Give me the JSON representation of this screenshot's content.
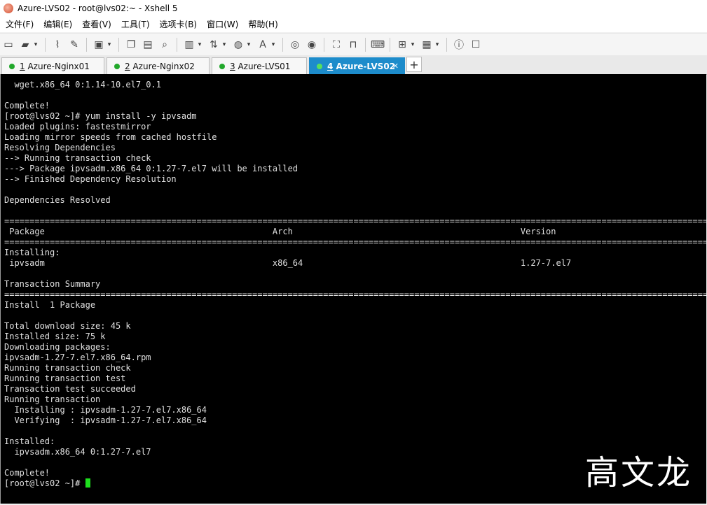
{
  "window": {
    "title": "Azure-LVS02 - root@lvs02:~ - Xshell 5"
  },
  "menu": [
    "文件(F)",
    "编辑(E)",
    "查看(V)",
    "工具(T)",
    "选项卡(B)",
    "窗口(W)",
    "帮助(H)"
  ],
  "tabs": [
    {
      "num": "1",
      "label": "Azure-Nginx01"
    },
    {
      "num": "2",
      "label": "Azure-Nginx02"
    },
    {
      "num": "3",
      "label": "Azure-LVS01"
    },
    {
      "num": "4",
      "label": "Azure-LVS02"
    }
  ],
  "terminal": {
    "text": "  wget.x86_64 0:1.14-10.el7_0.1\n\nComplete!\n[root@lvs02 ~]# yum install -y ipvsadm\nLoaded plugins: fastestmirror\nLoading mirror speeds from cached hostfile\nResolving Dependencies\n--> Running transaction check\n---> Package ipvsadm.x86_64 0:1.27-7.el7 will be installed\n--> Finished Dependency Resolution\n\nDependencies Resolved\n\n================================================================================================================================================================\n Package                                             Arch                                             Version                                             R\n================================================================================================================================================================\nInstalling:\n ipvsadm                                             x86_64                                           1.27-7.el7                                          b\n\nTransaction Summary\n================================================================================================================================================================\nInstall  1 Package\n\nTotal download size: 45 k\nInstalled size: 75 k\nDownloading packages:\nipvsadm-1.27-7.el7.x86_64.rpm\nRunning transaction check\nRunning transaction test\nTransaction test succeeded\nRunning transaction\n  Installing : ipvsadm-1.27-7.el7.x86_64\n  Verifying  : ipvsadm-1.27-7.el7.x86_64\n\nInstalled:\n  ipvsadm.x86_64 0:1.27-7.el7\n\nComplete!\n[root@lvs02 ~]# "
  },
  "watermark": "高文龙"
}
